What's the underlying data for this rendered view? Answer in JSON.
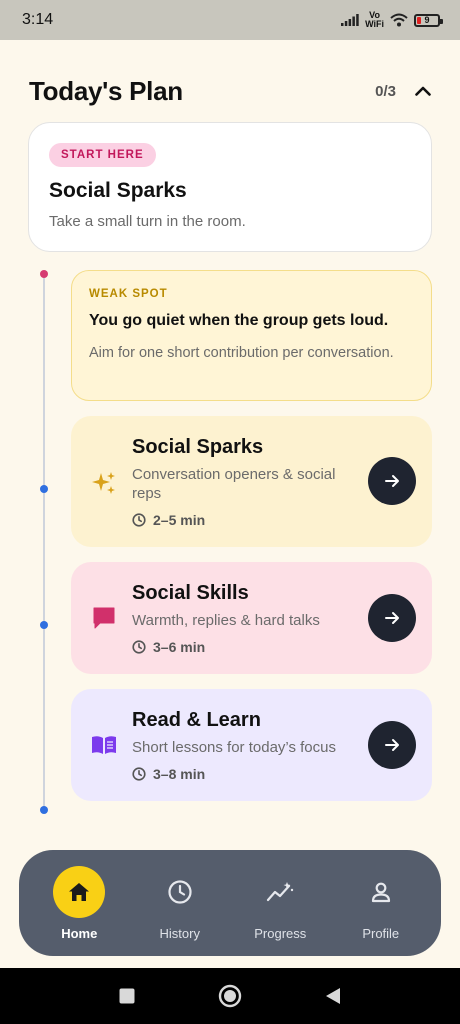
{
  "status_bar": {
    "time": "3:14",
    "volte_top": "Vo",
    "volte_bottom": "WiFi",
    "battery": "9"
  },
  "header": {
    "title": "Today's Plan",
    "progress": "0/3"
  },
  "start_card": {
    "badge": "START HERE",
    "title": "Social Sparks",
    "subtitle": "Take a small turn in the room."
  },
  "weak_spot": {
    "label": "WEAK SPOT",
    "title": "You go quiet when the group gets loud.",
    "body": "Aim for one short contribution per conversation."
  },
  "activities": [
    {
      "title": "Social Sparks",
      "subtitle": "Conversation openers & social reps",
      "time": "2–5 min",
      "icon": "sparkles-icon",
      "color": "#fdf2d0"
    },
    {
      "title": "Social Skills",
      "subtitle": "Warmth, replies & hard talks",
      "time": "3–6 min",
      "icon": "chat-bubble-icon",
      "color": "#fde0e6"
    },
    {
      "title": "Read & Learn",
      "subtitle": "Short lessons for today’s focus",
      "time": "3–8 min",
      "icon": "book-icon",
      "color": "#ede9fe"
    }
  ],
  "nav": {
    "items": [
      {
        "label": "Home",
        "icon": "home-icon"
      },
      {
        "label": "History",
        "icon": "clock-icon"
      },
      {
        "label": "Progress",
        "icon": "chart-icon"
      },
      {
        "label": "Profile",
        "icon": "person-icon"
      }
    ],
    "accent": "#f9d015",
    "background": "#555d6c"
  }
}
